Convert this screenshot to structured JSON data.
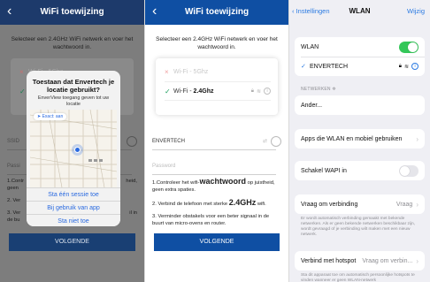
{
  "left": {
    "header_title": "WiFi toewijzing",
    "back_glyph": "‹",
    "instruction": "Selecteer een 2.4GHz WiFi netwerk en voer het wachtwoord in.",
    "wifi_disabled": "Wi-Fi - 5Ghz",
    "field_ssid_partial": "SSID",
    "field_pass_partial": "Passi",
    "step1_partial": "1.Contr",
    "step1_tail": "heid,",
    "step1_line2": "geen",
    "step2_partial": "2. Ver",
    "step3_partial": "3. Ver",
    "step3_tail": "il in",
    "step3_line2": "de bu",
    "cta": "VOLGENDE",
    "dialog": {
      "title": "Toestaan dat Envertech je locatie gebruikt?",
      "subtitle": "EnverView toegang geven tot uw locatie",
      "exact_label": "Exact: aan",
      "btn_once": "Sta één sessie toe",
      "btn_while_using": "Bij gebruik van app",
      "btn_deny": "Sta niet toe"
    }
  },
  "middle": {
    "header_title": "WiFi toewijzing",
    "back_glyph": "‹",
    "instruction": "Selecteer een 2.4GHz WiFi netwerk en voer het wachtwoord in.",
    "wifi_list": {
      "disabled": {
        "mark": "×",
        "prefix": "Wi-Fi - ",
        "name": "5Ghz"
      },
      "selected": {
        "mark": "✓",
        "prefix": "Wi-Fi - ",
        "name": "2.4Ghz"
      }
    },
    "ssid_value": "ENVERTECH",
    "password_placeholder": "Password",
    "step1_a": "1.Controleer het wifi-",
    "step1_big": "wachtwoord",
    "step1_b": " op juistheid, geen extra spaties.",
    "step2_a": "2. Verbind de telefoon met sterke ",
    "step2_big": "2.4GHz",
    "step2_b": " wifi.",
    "step3": "3. Verminder obstakels voor een beter signaal in de buurt van micro-ovens en router.",
    "cta": "VOLGENDE"
  },
  "right": {
    "back_label": "‹ Instellingen",
    "title": "WLAN",
    "edit_label": "Wijzig",
    "wlan_label": "WLAN",
    "wlan_on": true,
    "connected_name": "ENVERTECH",
    "networks_header": "NETWERKEN",
    "other_label": "Ander...",
    "apps_label": "Apps die WLAN en mobiel gebruiken",
    "wapi_label": "Schakel WAPI in",
    "wapi_on": false,
    "ask_label": "Vraag om verbinding",
    "ask_value": "Vraag",
    "ask_footer": "Er wordt automatisch verbinding gemaakt met bekende netwerken. Als er geen bekende netwerken beschikbaar zijn, wordt gevraagd of je verbinding wilt maken met een nieuw netwerk.",
    "hotspot_label": "Verbind met hotspot",
    "hotspot_value": "Vraag om verbin...",
    "hotspot_footer": "Sta dit apparaat toe om automatisch persoonlijke hotspots te vinden wanneer er geen WLAN-netwerk"
  }
}
